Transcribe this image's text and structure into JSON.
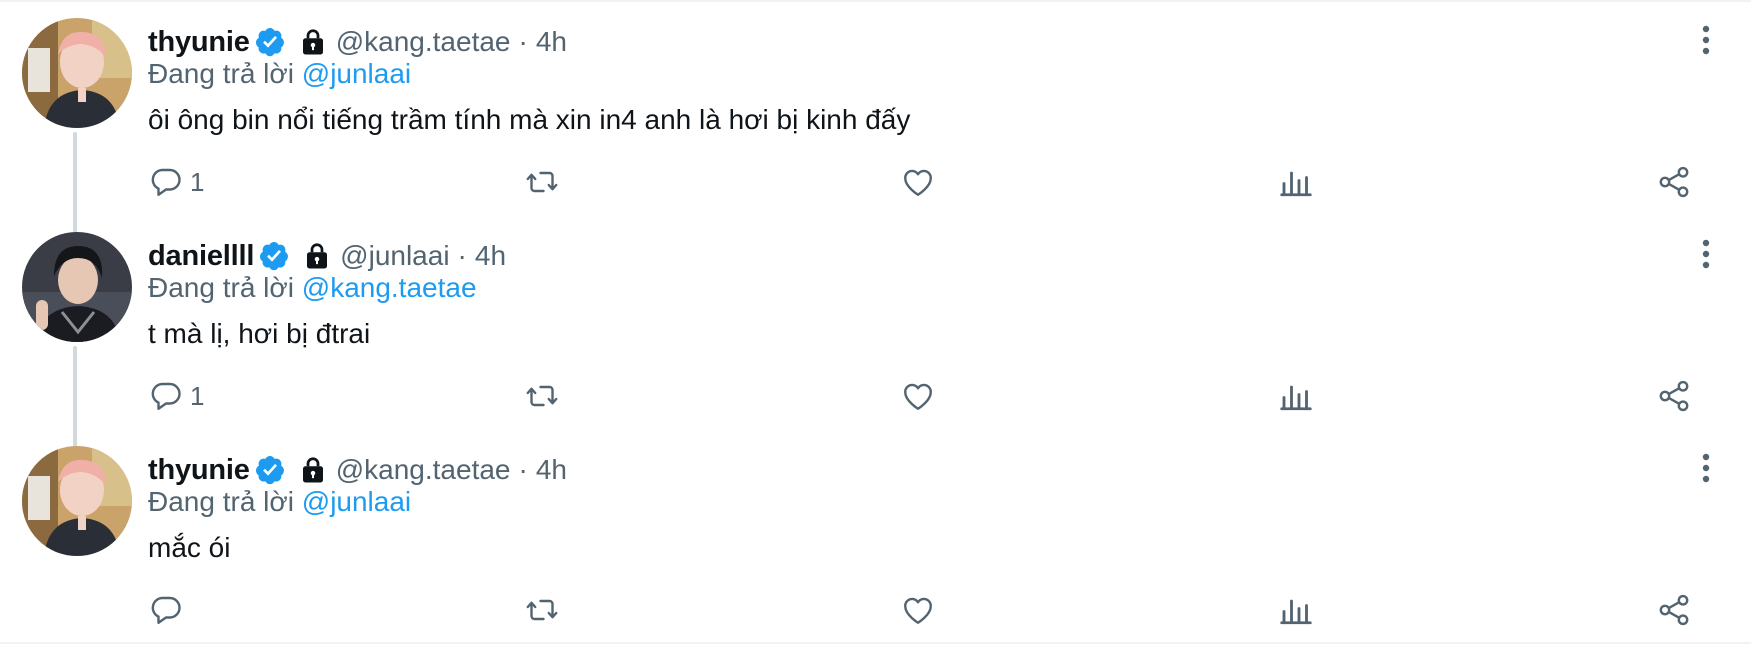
{
  "replying_prefix": "Đang trả lời",
  "tweets": [
    {
      "name": "thyunie",
      "handle": "@kang.taetae",
      "separator": "·",
      "time": "4h",
      "reply_to": "@junlaai",
      "text": "ôi ông bin nổi tiếng trầm tính mà xin in4 anh là hơi bị kinh đấy",
      "reply_count": "1"
    },
    {
      "name": "daniellll",
      "handle": "@junlaai",
      "separator": "·",
      "time": "4h",
      "reply_to": "@kang.taetae",
      "text": "t mà lị, hơi bị đtrai",
      "reply_count": "1"
    },
    {
      "name": "thyunie",
      "handle": "@kang.taetae",
      "separator": "·",
      "time": "4h",
      "reply_to": "@junlaai",
      "text": "mắc ói",
      "reply_count": ""
    }
  ],
  "icons": {
    "verified": "verified-badge-icon",
    "lock": "lock-icon",
    "more": "more-vertical-icon",
    "reply": "reply-icon",
    "retweet": "retweet-icon",
    "like": "heart-icon",
    "views": "analytics-icon",
    "share": "share-icon"
  },
  "colors": {
    "accent": "#1d9bf0",
    "secondary_text": "#536471",
    "primary_text": "#0f1419",
    "thread_line": "#cfd9de"
  }
}
